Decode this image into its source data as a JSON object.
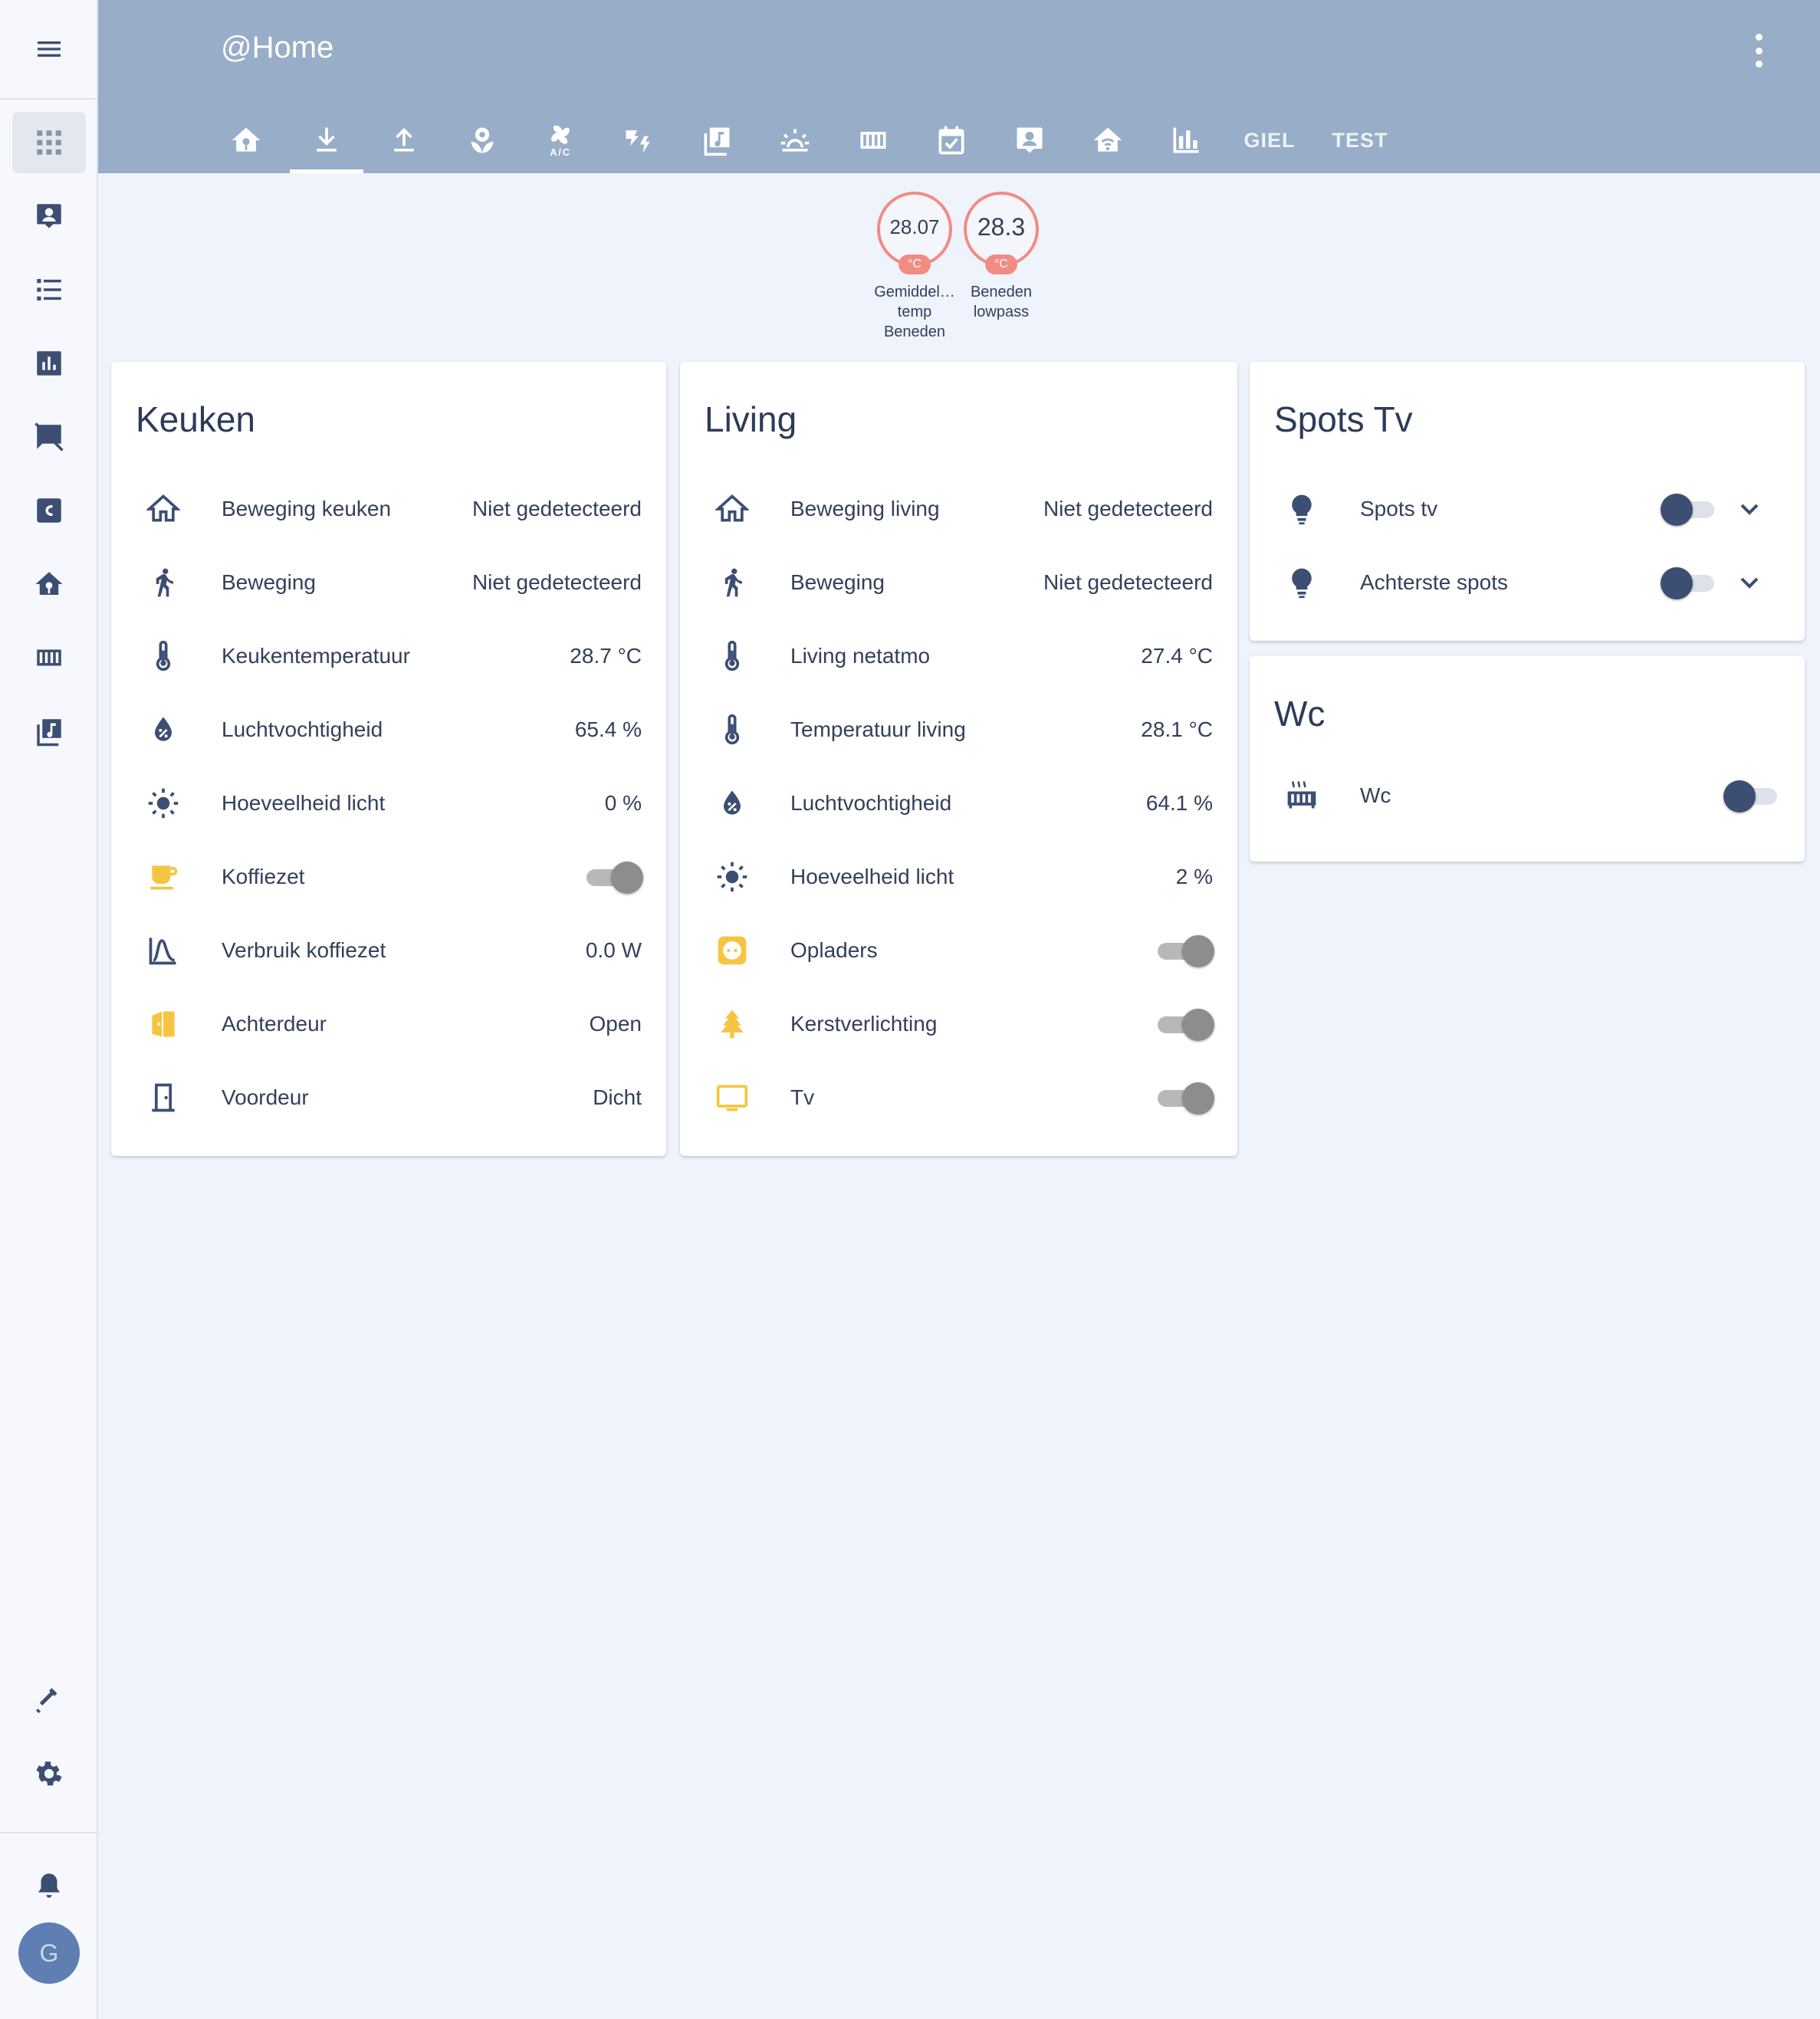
{
  "app": {
    "title": "@Home"
  },
  "tabs": [
    {
      "icon": "home-flower-icon"
    },
    {
      "icon": "download-icon",
      "active": true
    },
    {
      "icon": "upload-icon"
    },
    {
      "icon": "flower-icon"
    },
    {
      "icon": "fan-ac-icon"
    },
    {
      "icon": "weather-lightning-icon"
    },
    {
      "icon": "music-box-icon"
    },
    {
      "icon": "weather-sunset-icon"
    },
    {
      "icon": "radiator-icon"
    },
    {
      "icon": "calendar-check-icon"
    },
    {
      "icon": "account-box-icon"
    },
    {
      "icon": "home-wifi-icon"
    },
    {
      "icon": "chart-bar-icon"
    },
    {
      "label": "GIEL"
    },
    {
      "label": "TEST"
    }
  ],
  "sidebar": {
    "items": [
      "grid-icon",
      "account-box-icon",
      "format-list-icon",
      "chart-box-icon",
      "message-off-icon",
      "letter-c-icon",
      "home-flower-icon",
      "radiator-icon",
      "music-box-icon"
    ],
    "bottom": [
      "hammer-icon",
      "settings-icon",
      "bell-icon"
    ],
    "avatar": "G"
  },
  "badges": [
    {
      "value": "28.07",
      "unit": "°C",
      "label_lines": [
        "Gemiddel…",
        "temp",
        "Beneden"
      ]
    },
    {
      "value": "28.3",
      "unit": "°C",
      "label_lines": [
        "Beneden",
        "lowpass"
      ]
    }
  ],
  "cards": {
    "keuken": {
      "title": "Keuken",
      "rows": [
        {
          "icon": "home-outline-icon",
          "name": "Beweging keuken",
          "value": "Niet gedetecteerd"
        },
        {
          "icon": "walk-icon",
          "name": "Beweging",
          "value": "Niet gedetecteerd"
        },
        {
          "icon": "thermometer-icon",
          "name": "Keukentemperatuur",
          "value": "28.7 °C"
        },
        {
          "icon": "water-percent-icon",
          "name": "Luchtvochtigheid",
          "value": "65.4 %"
        },
        {
          "icon": "brightness-icon",
          "name": "Hoeveelheid licht",
          "value": "0 %"
        },
        {
          "icon": "coffee-icon",
          "name": "Koffiezet",
          "toggle": "on",
          "icon_color": "#f5c542"
        },
        {
          "icon": "chart-bell-curve-icon",
          "name": "Verbruik koffiezet",
          "value": "0.0 W"
        },
        {
          "icon": "door-open-icon",
          "name": "Achterdeur",
          "value": "Open",
          "icon_color": "#f5c542"
        },
        {
          "icon": "door-closed-icon",
          "name": "Voordeur",
          "value": "Dicht"
        }
      ]
    },
    "living": {
      "title": "Living",
      "rows": [
        {
          "icon": "home-outline-icon",
          "name": "Beweging living",
          "value": "Niet gedetecteerd"
        },
        {
          "icon": "walk-icon",
          "name": "Beweging",
          "value": "Niet gedetecteerd"
        },
        {
          "icon": "thermometer-icon",
          "name": "Living netatmo",
          "value": "27.4 °C"
        },
        {
          "icon": "thermometer-icon",
          "name": "Temperatuur living",
          "value": "28.1 °C"
        },
        {
          "icon": "water-percent-icon",
          "name": "Luchtvochtigheid",
          "value": "64.1 %"
        },
        {
          "icon": "brightness-icon",
          "name": "Hoeveelheid licht",
          "value": "2 %"
        },
        {
          "icon": "power-socket-icon",
          "name": "Opladers",
          "toggle": "on",
          "icon_color": "#f5c542"
        },
        {
          "icon": "pine-tree-icon",
          "name": "Kerstverlichting",
          "toggle": "on",
          "icon_color": "#f5c542"
        },
        {
          "icon": "television-icon",
          "name": "Tv",
          "toggle": "on",
          "icon_color": "#f5c542"
        }
      ]
    },
    "spots": {
      "title": "Spots Tv",
      "rows": [
        {
          "icon": "lightbulb-icon",
          "name": "Spots tv",
          "toggle": "off"
        },
        {
          "icon": "lightbulb-icon",
          "name": "Achterste spots",
          "toggle": "off"
        }
      ]
    },
    "wc": {
      "title": "Wc",
      "rows": [
        {
          "icon": "radiator-icon",
          "name": "Wc",
          "toggle": "off"
        }
      ]
    }
  },
  "colors": {
    "header": "#98adc8",
    "background": "#eef3fc",
    "icon": "#3d4e73",
    "active_yellow": "#f5c542",
    "badge_red": "#f08c84"
  }
}
